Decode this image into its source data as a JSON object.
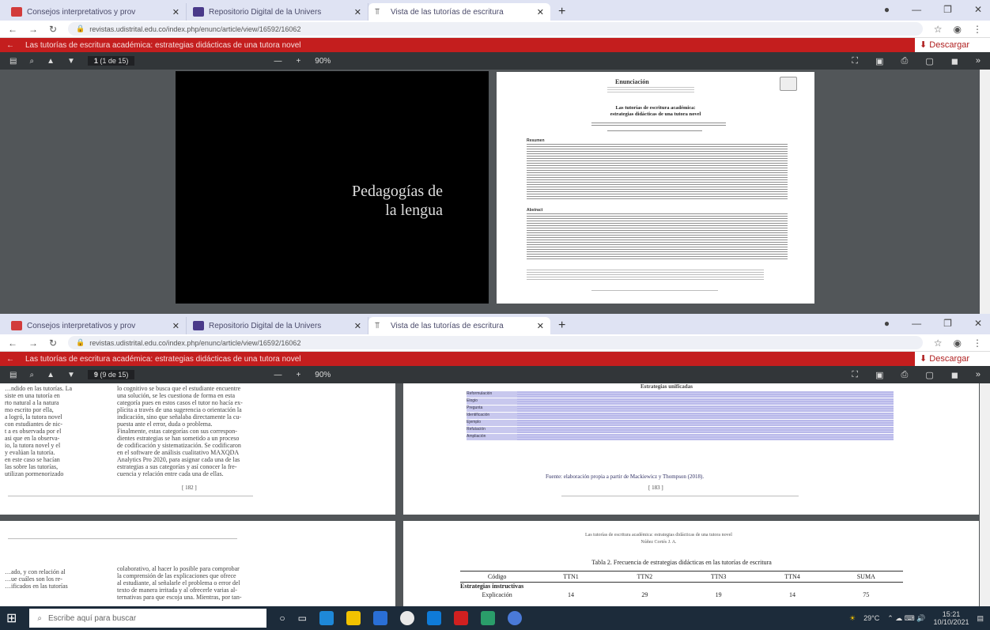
{
  "browser": {
    "tabs": [
      {
        "title": "Consejos interpretativos y prov",
        "icon": "ms-icon",
        "color": "#d23b3b"
      },
      {
        "title": "Repositorio Digital de la Univers",
        "icon": "repo-icon",
        "color": "#4a3a8a"
      },
      {
        "title": "Vista de las tutorías de escritura",
        "icon": "ojs-icon",
        "color": "#555555"
      }
    ],
    "url": "revistas.udistrital.edu.co/index.php/enunc/article/view/16592/16062"
  },
  "article_bar": {
    "title": "Las tutorías de escritura académica: estrategias didácticas de una tutora novel",
    "download": "Descargar",
    "accent": "#c41e1e"
  },
  "pdf_toolbar": {
    "page_top": "1",
    "page_bottom": "9",
    "page_total": "(1 de 15)",
    "page_total_bottom": "(9 de 15)",
    "zoom": "90%"
  },
  "cover": {
    "line1": "Pedagogías de",
    "line2": "la lengua"
  },
  "first_page": {
    "journal": "Enunciación",
    "article_title": "Las tutorías de escritura académica:\nestrategias didácticas de una tutora novel",
    "resumen_label": "Resumen",
    "abstract_label": "Abstract"
  },
  "reading": {
    "left_col_a": "…ndido en las tutorías. La\nsiste en una tutoría en\nrto natural a la natura\nmo escrito por ella,\na logró, la tutora novel\ncon estudiantes de nic-\nt a es observada por el\nasi que en la observa-\nio, la tutora novel y el\ny evalúan la tutoría.\nen este caso se hacían\nlas sobre las tutorías,\nutilizan pormenorizado",
    "left_col_b": "lo cognitivo se busca que el estudiante encuentre\nuna solución, se les cuestiona de forma en esta\ncategoría pues en estos casos el tutor no hacía ex-\nplícita a través de una sugerencia o orientación la\nindicación, sino que señalaba directamente la cu-\npuesta ante el error, duda o problema.\n   Finalmente, estas categorías con sus correspon-\ndientes estrategias se han sometido a un proceso\nde codificación y sistematización. Se codificaron\nen el software de análisis cualitativo MAXQDA\nAnalytics Pro 2020, para asignar cada una de las\nestrategias a sus categorías y así conocer la fre-\ncuencia y relación entre cada una de ellas.",
    "page_num_left": "[ 182 ]",
    "page_num_right": "[ 183 ]",
    "table1_title": "Estrategias unificadas",
    "table1_rows": [
      "Reformulación",
      "Elogio",
      "Pregunta",
      "Identificación",
      "Ejemplo",
      "Refutación",
      "Ampliación"
    ],
    "fuente": "Fuente: elaboración propia a partir de Mackiewicz y Thompson (2018).",
    "left_col_c": "colaborativo, al hacer lo posible para comprobar\nla comprensión de las explicaciones que ofrece\nal estudiante, al señalarle el problema o error del\ntexto de manera irritada y al ofrecerle varias al-\nternativas para que escoja una. Mientras, por tan-",
    "running_head": "Las tutorías de escritura académica: estrategias didácticas de una tutora novel\nNúñez Cortés J. A.",
    "table2_caption": "Tabla 2. Frecuencia de estrategias didácticas en las tutorías de escritura",
    "table2_headers": [
      "Código",
      "TTN1",
      "TTN2",
      "TTN3",
      "TTN4",
      "SUMA"
    ],
    "table2_group": "Estrategias instructivas",
    "table2_row": [
      "Explicación",
      "14",
      "29",
      "19",
      "14",
      "75"
    ]
  },
  "taskbar": {
    "search_placeholder": "Escribe aquí para buscar",
    "temperature": "29°C",
    "time": "15:21",
    "date": "10/10/2021"
  }
}
